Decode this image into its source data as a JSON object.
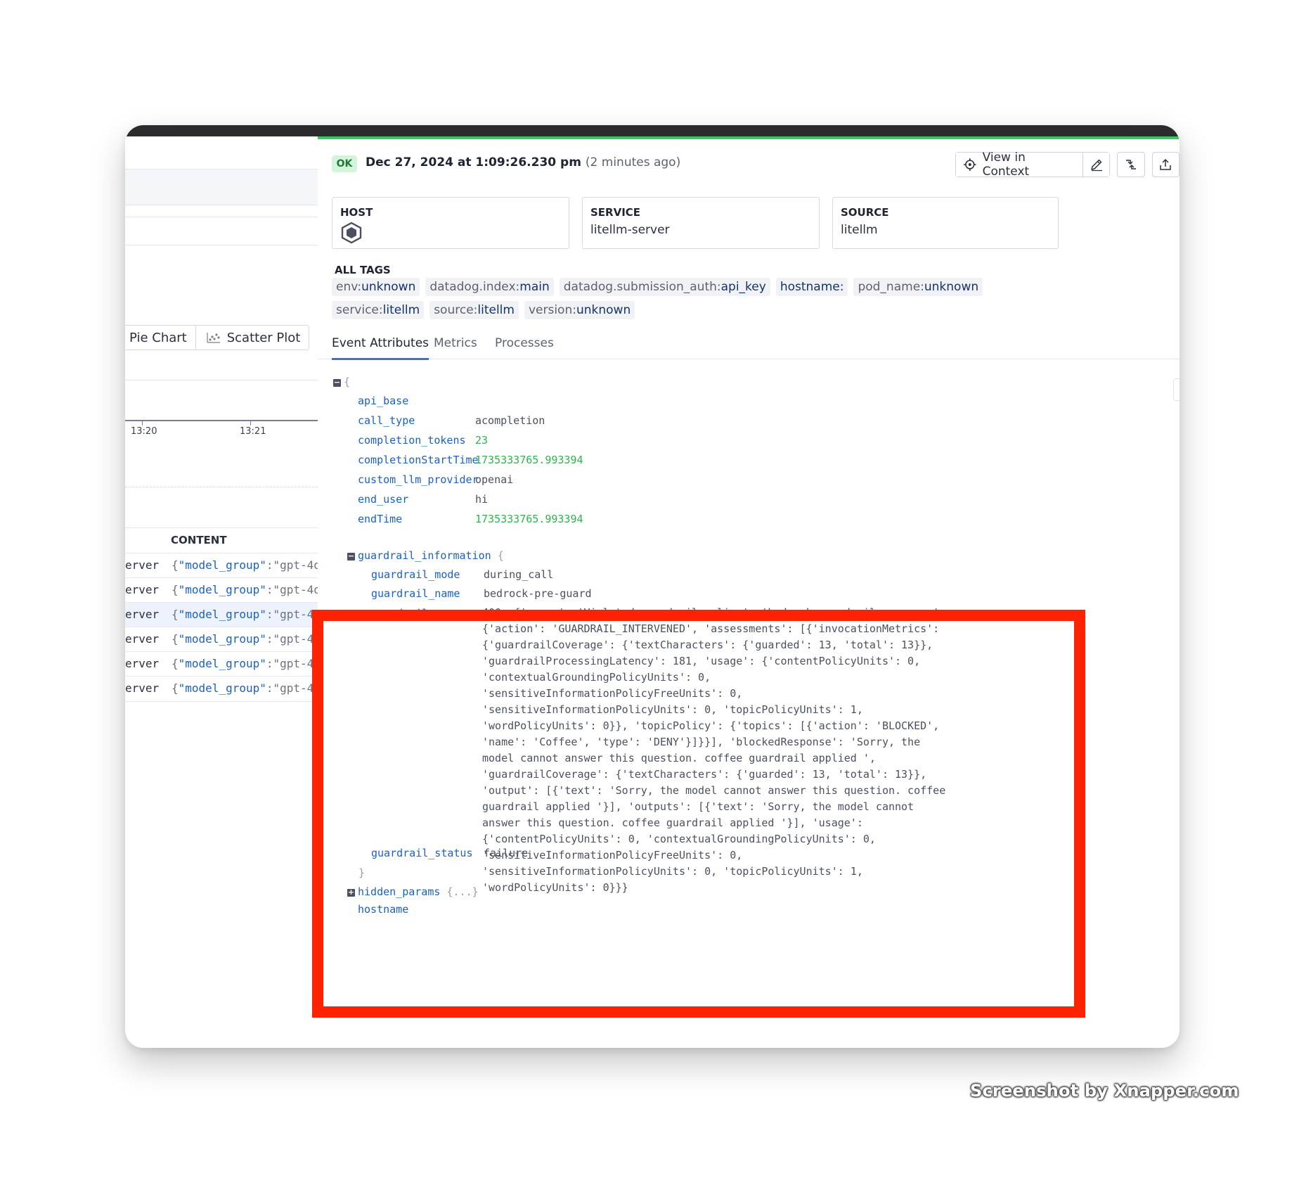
{
  "left_panel": {
    "viz_tabs": [
      {
        "label": "Pie Chart",
        "icon": "pie-chart-icon"
      },
      {
        "label": "Scatter Plot",
        "icon": "scatter-plot-icon"
      }
    ],
    "axis_ticks": [
      "13:20",
      "13:21"
    ],
    "content_header": "CONTENT",
    "rows": [
      {
        "service": "erver",
        "key": "\"model_group\"",
        "rest": ":\"gpt-4o"
      },
      {
        "service": "erver",
        "key": "\"model_group\"",
        "rest": ":\"gpt-4o"
      },
      {
        "service": "erver",
        "key": "\"model_group\"",
        "rest": ":\"gpt-4"
      },
      {
        "service": "erver",
        "key": "\"model_group\"",
        "rest": ":\"gpt-4"
      },
      {
        "service": "erver",
        "key": "\"model_group\"",
        "rest": ":\"gpt-4"
      },
      {
        "service": "erver",
        "key": "\"model_group\"",
        "rest": ":\"gpt-4"
      }
    ]
  },
  "header": {
    "status": "OK",
    "date": "Dec 27, 2024 at 1:09:26.230 pm",
    "relative": "(2 minutes ago)",
    "view_in_context": "View in Context",
    "colors": {
      "ok_bg": "#d4f5dc",
      "ok_text": "#1f7a36",
      "accent": "#3f6fd8",
      "status_bar": "#3cc465"
    }
  },
  "cards": {
    "host": {
      "title": "HOST",
      "value": ""
    },
    "service": {
      "title": "SERVICE",
      "value": "litellm-server"
    },
    "source": {
      "title": "SOURCE",
      "value": "litellm"
    }
  },
  "tags": {
    "title": "ALL TAGS",
    "items": [
      {
        "k": "env:",
        "v": "unknown"
      },
      {
        "k": "datadog.index:",
        "v": "main"
      },
      {
        "k": "datadog.submission_auth:",
        "v": "api_key"
      },
      {
        "k": "",
        "v": "hostname:"
      },
      {
        "k": "pod_name:",
        "v": "unknown"
      },
      {
        "k": "service:",
        "v": "litellm"
      },
      {
        "k": "source:",
        "v": "litellm"
      },
      {
        "k": "version:",
        "v": "unknown"
      }
    ]
  },
  "tabs": [
    "Event Attributes",
    "Metrics",
    "Processes"
  ],
  "attributes": {
    "open_brace": "{",
    "top": [
      {
        "key": "api_base",
        "value": "",
        "type": "string"
      },
      {
        "key": "call_type",
        "value": "acompletion",
        "type": "string"
      },
      {
        "key": "completion_tokens",
        "value": "23",
        "type": "number"
      },
      {
        "key": "completionStartTime",
        "value": "1735333765.993394",
        "type": "number"
      },
      {
        "key": "custom_llm_provider",
        "value": "openai",
        "type": "string"
      },
      {
        "key": "end_user",
        "value": "hi",
        "type": "string"
      },
      {
        "key": "endTime",
        "value": "1735333765.993394",
        "type": "number"
      }
    ],
    "guardrail_information": {
      "key": "guardrail_information",
      "brace": "{",
      "close_brace": "}",
      "fields": [
        {
          "key": "guardrail_mode",
          "value": "during_call"
        },
        {
          "key": "guardrail_name",
          "value": "bedrock-pre-guard"
        }
      ],
      "response_key": "guardrail_response",
      "response_value": "400: {'error': 'Violated guardrail policy', 'bedrock_guardrail_response': {'action': 'GUARDRAIL_INTERVENED', 'assessments': [{'invocationMetrics': {'guardrailCoverage': {'textCharacters': {'guarded': 13, 'total': 13}}, 'guardrailProcessingLatency': 181, 'usage': {'contentPolicyUnits': 0, 'contextualGroundingPolicyUnits': 0, 'sensitiveInformationPolicyFreeUnits': 0, 'sensitiveInformationPolicyUnits': 0, 'topicPolicyUnits': 1, 'wordPolicyUnits': 0}}, 'topicPolicy': {'topics': [{'action': 'BLOCKED', 'name': 'Coffee', 'type': 'DENY'}]}}], 'blockedResponse': 'Sorry, the model cannot answer this question. coffee guardrail applied ', 'guardrailCoverage': {'textCharacters': {'guarded': 13, 'total': 13}}, 'output': [{'text': 'Sorry, the model cannot answer this question. coffee guardrail applied '}], 'outputs': [{'text': 'Sorry, the model cannot answer this question. coffee guardrail applied '}], 'usage': {'contentPolicyUnits': 0, 'contextualGroundingPolicyUnits': 0, 'sensitiveInformationPolicyFreeUnits': 0, 'sensitiveInformationPolicyUnits': 0, 'topicPolicyUnits': 1, 'wordPolicyUnits': 0}}}",
      "status_key": "guardrail_status",
      "status_value": "failure"
    },
    "hidden_params": {
      "key": "hidden_params",
      "collapsed": "{...}"
    },
    "hostname": {
      "key": "hostname"
    }
  },
  "highlight_color": "#ff2200",
  "watermark": "Screenshot by Xnapper.com"
}
